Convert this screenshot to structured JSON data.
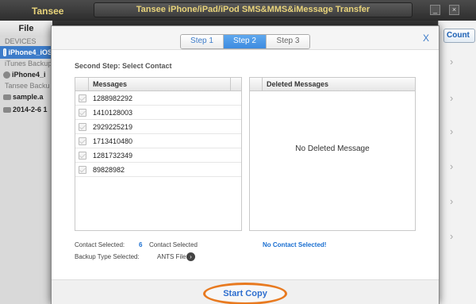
{
  "app": {
    "name": "Tansee",
    "title": "Tansee iPhone/iPad/iPod SMS&MMS&iMessage Transfer",
    "minimize_icon": "minimize-icon",
    "close_icon": "close-icon"
  },
  "sidebar": {
    "file_label": "File",
    "devices_heading": "DEVICES",
    "device_name": "iPhone4_iOS",
    "itunes_heading": "iTunes Backup",
    "itunes_item": "iPhone4_i",
    "tansee_heading": "Tansee Backu",
    "backups": [
      "sample.a",
      "2014-2-6 1"
    ]
  },
  "right_panel": {
    "count_button": "Count",
    "chevron": "›"
  },
  "dialog": {
    "steps": [
      "Step 1",
      "Step 2",
      "Step 3"
    ],
    "active_step": "Step 2",
    "close_label": "X",
    "subtitle": "Second Step: Select Contact",
    "messages_header": "Messages",
    "messages": [
      "1288982292",
      "1410128003",
      "2929225219",
      "1713410480",
      "1281732349",
      "89828982"
    ],
    "deleted_header": "Deleted Messages",
    "no_deleted": "No Deleted Message",
    "contact_selected_label": "Contact Selected:",
    "contact_selected_count": "6",
    "contact_selected_suffix": "Contact Selected",
    "no_contact_selected": "No Contact Selected!",
    "backup_type_label": "Backup Type Selected:",
    "backup_type_value": "ANTS File",
    "start_copy": "Start Copy"
  },
  "colors": {
    "accent_blue": "#3d8be0",
    "link_blue": "#1a6fd1",
    "highlight_orange": "#e87a20",
    "title_gold": "#e8d37a"
  }
}
